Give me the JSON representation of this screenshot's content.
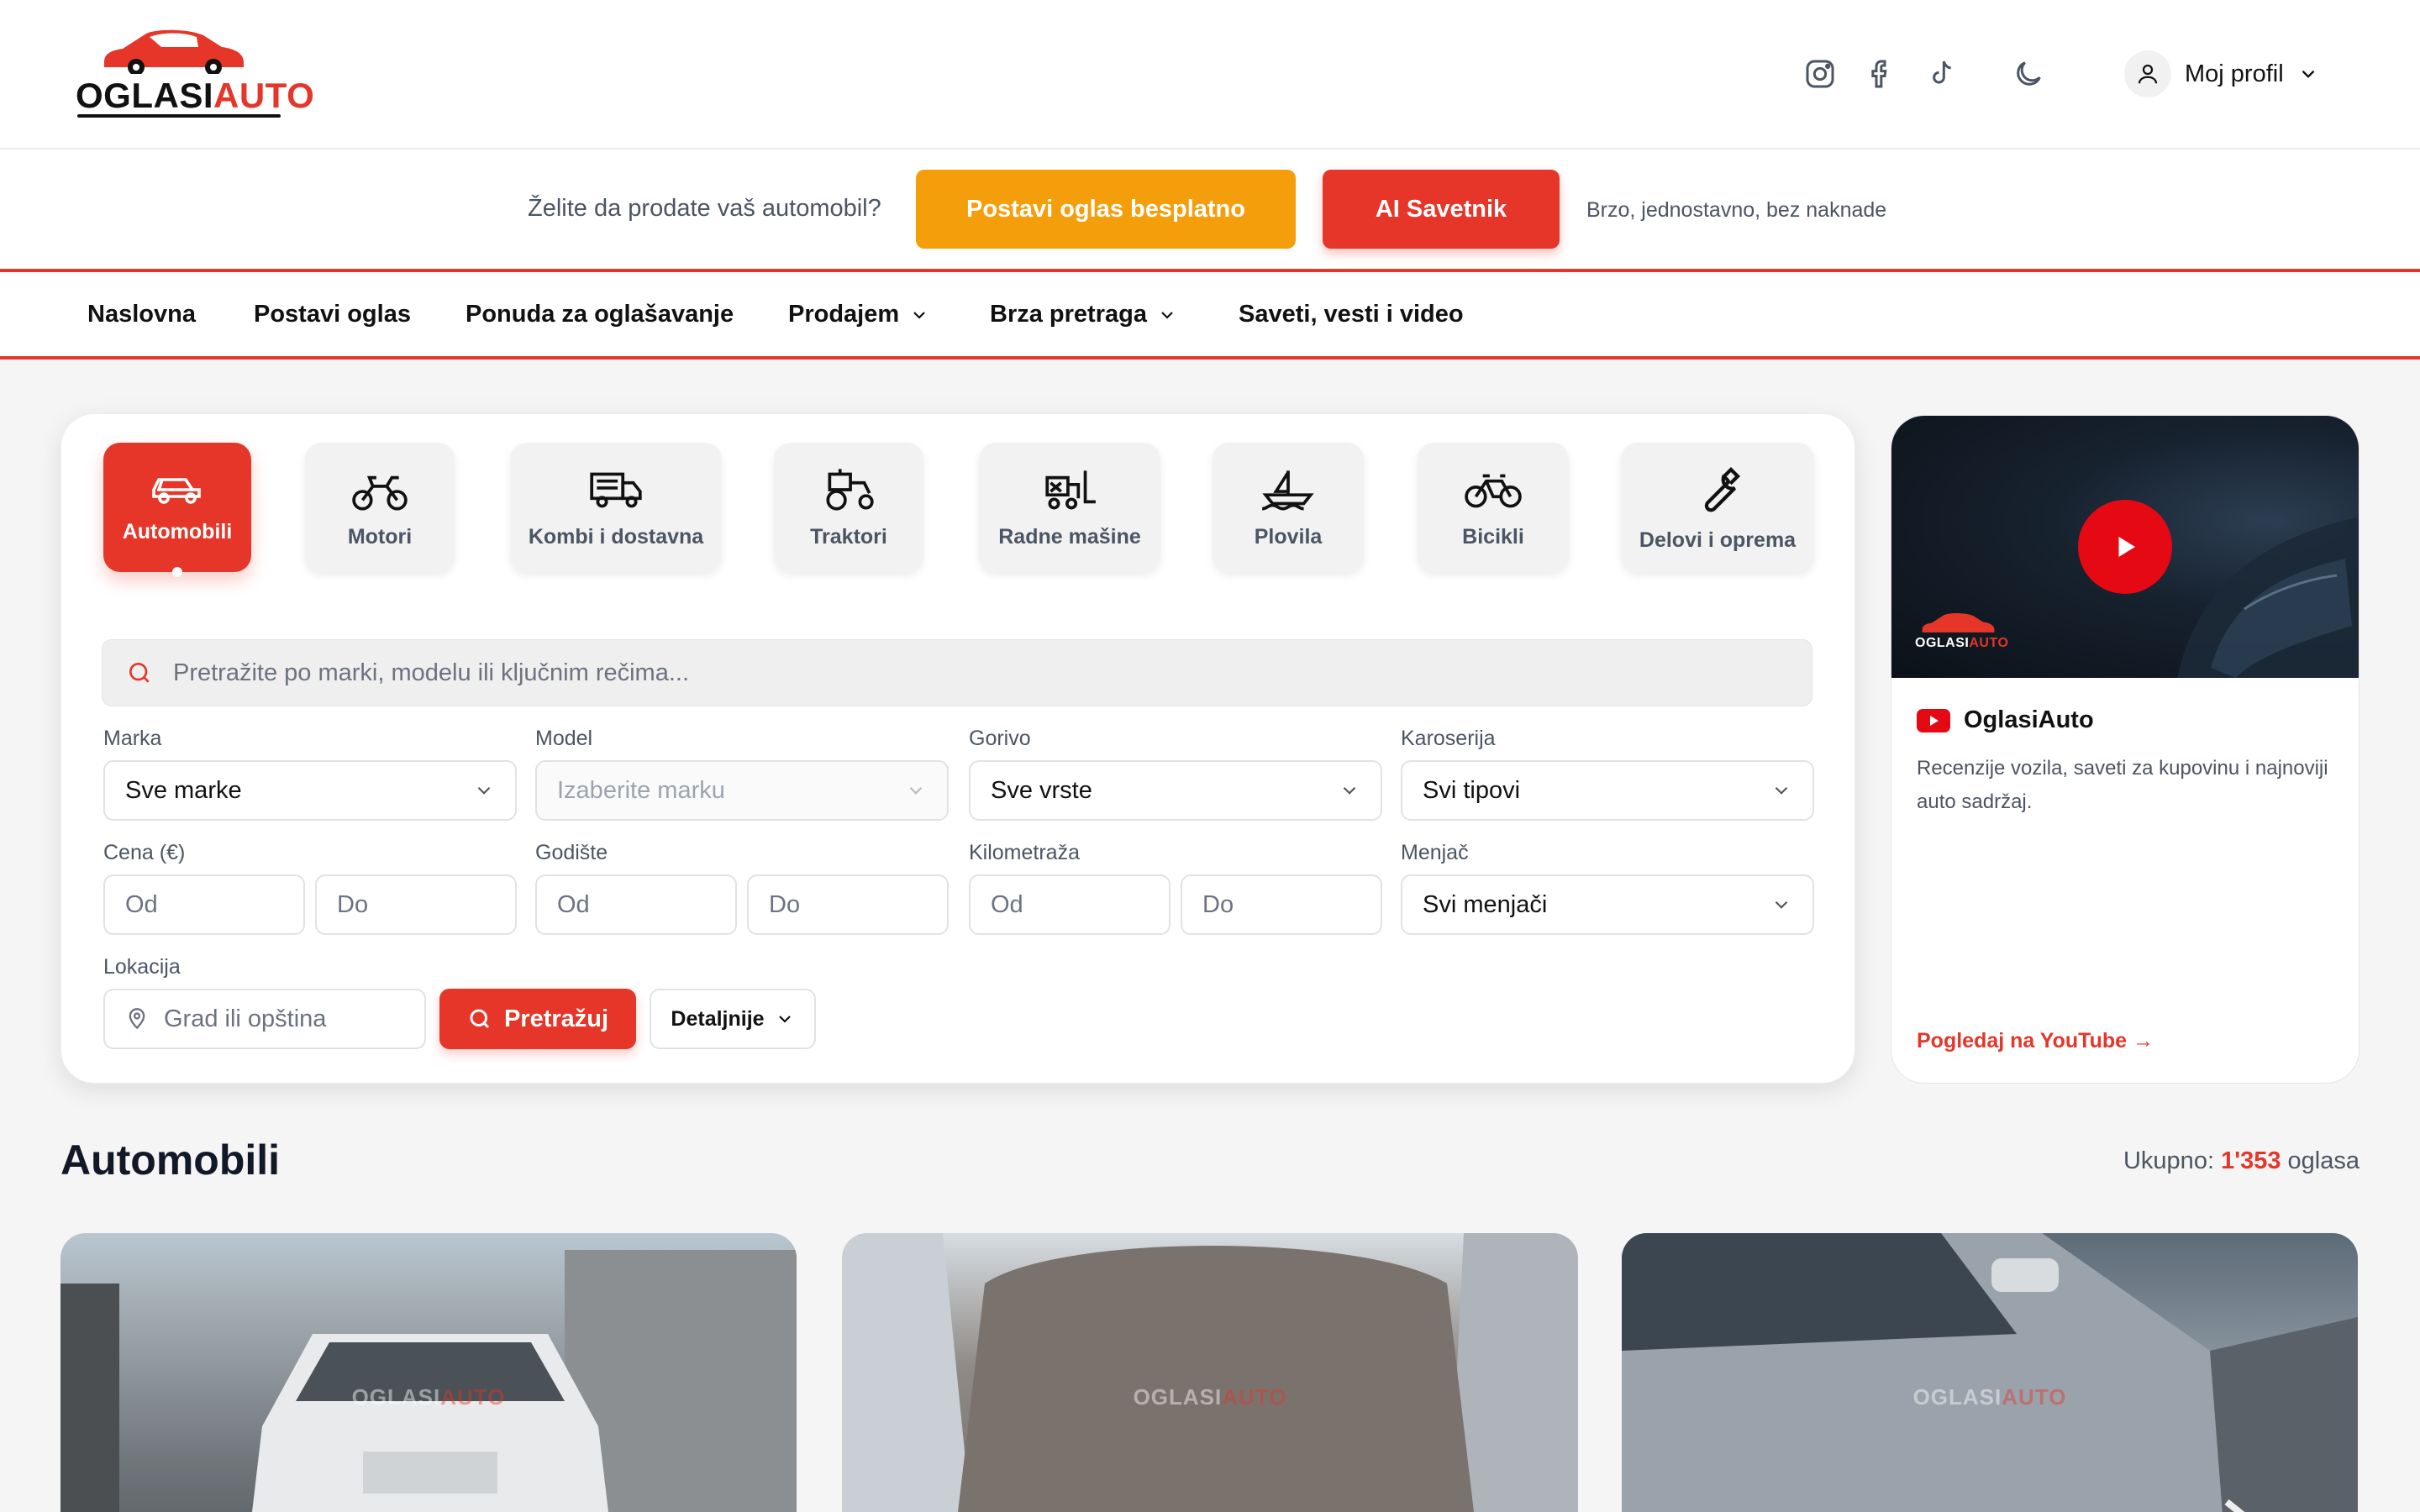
{
  "brand": {
    "logo_part1": "OGLASI",
    "logo_part2": "AUTO"
  },
  "header": {
    "social": [
      "instagram-icon",
      "facebook-icon",
      "tiktok-icon"
    ],
    "theme_toggle": "moon-icon",
    "profile_label": "Moj profil"
  },
  "promo": {
    "question": "Želite da prodate vaš automobil?",
    "post_ad_label": "Postavi oglas besplatno",
    "ai_label": "AI Savetnik",
    "tagline": "Brzo, jednostavno, bez naknade"
  },
  "nav": {
    "items": [
      {
        "label": "Naslovna"
      },
      {
        "label": "Postavi oglas"
      },
      {
        "label": "Ponuda za oglašavanje"
      },
      {
        "label": "Prodajem"
      },
      {
        "label": "Brza pretraga"
      },
      {
        "label": "Saveti, vesti i video"
      }
    ]
  },
  "categories": [
    {
      "label": "Automobili",
      "icon": "car-icon",
      "active": true
    },
    {
      "label": "Motori",
      "icon": "motorcycle-icon"
    },
    {
      "label": "Kombi i dostavna",
      "icon": "van-icon"
    },
    {
      "label": "Traktori",
      "icon": "tractor-icon"
    },
    {
      "label": "Radne mašine",
      "icon": "forklift-icon"
    },
    {
      "label": "Plovila",
      "icon": "boat-icon"
    },
    {
      "label": "Bicikli",
      "icon": "bicycle-icon"
    },
    {
      "label": "Delovi i oprema",
      "icon": "wrench-icon"
    }
  ],
  "search": {
    "placeholder": "Pretražite po marki, modelu ili ključnim rečima...",
    "filters": {
      "marka": {
        "label": "Marka",
        "value": "Sve marke"
      },
      "model": {
        "label": "Model",
        "value": "Izaberite marku"
      },
      "gorivo": {
        "label": "Gorivo",
        "value": "Sve vrste"
      },
      "karoserija": {
        "label": "Karoserija",
        "value": "Svi tipovi"
      },
      "cena": {
        "label": "Cena (€)",
        "from": "Od",
        "to": "Do"
      },
      "godiste": {
        "label": "Godište",
        "from": "Od",
        "to": "Do"
      },
      "kilometraza": {
        "label": "Kilometraža",
        "from": "Od",
        "to": "Do"
      },
      "menjac": {
        "label": "Menjač",
        "value": "Svi menjači"
      },
      "lokacija": {
        "label": "Lokacija",
        "placeholder": "Grad ili opština"
      }
    },
    "submit_label": "Pretražuj",
    "details_label": "Detaljnije"
  },
  "youtube": {
    "channel": "OgłasiAuto",
    "channel_name": "OglasiAuto",
    "description": "Recenzije vozila, saveti za kupovinu i najnoviji auto sadržaj.",
    "link_label": "Pogledaj na YouTube →",
    "thumb_logo1": "OGLASI",
    "thumb_logo2": "AUTO"
  },
  "listings": {
    "title": "Automobili",
    "total_prefix": "Ukupno: ",
    "total_count": "1'353",
    "total_suffix": " oglasa",
    "watermark1": "OGLASI",
    "watermark2": "AUTO"
  },
  "colors": {
    "accent": "#e53629",
    "orange": "#f59e0b",
    "youtube": "#e50914"
  }
}
